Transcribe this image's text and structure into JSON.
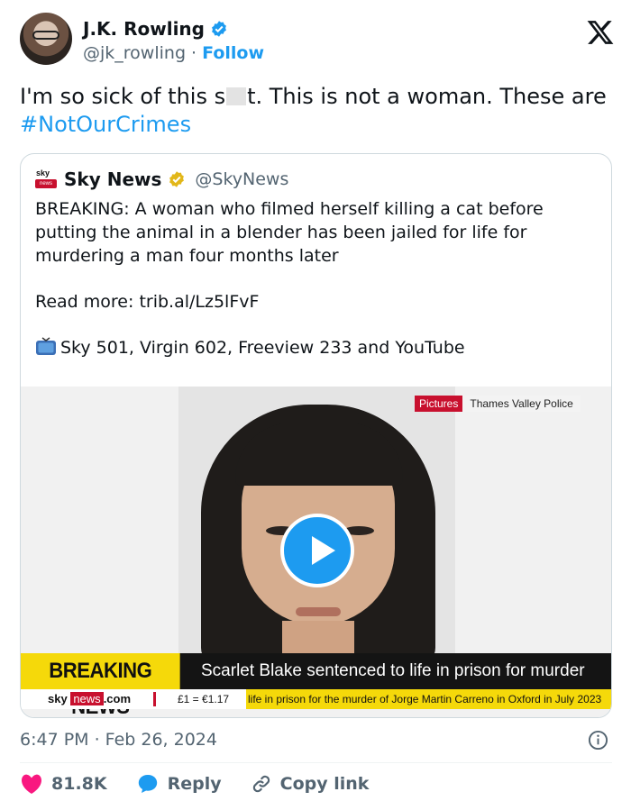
{
  "author": {
    "name": "J.K. Rowling",
    "handle": "@jk_rowling",
    "separator": " · ",
    "follow_label": "Follow"
  },
  "tweet": {
    "text_before": "I'm so sick of this s",
    "text_after": "t. This is not a woman. These are ",
    "hashtag": "#NotOurCrimes"
  },
  "quoted": {
    "logo_text": "sky",
    "logo_sub": "news",
    "name": "Sky News",
    "handle": "@SkyNews",
    "paragraph1": "BREAKING: A woman who filmed herself killing a cat before putting the animal in a blender has been jailed for life for murdering a man four months later",
    "paragraph2": "Read more: trib.al/Lz5lFvF",
    "paragraph3": "Sky 501, Virgin 602, Freeview 233 and YouTube",
    "video": {
      "credit_label": "Pictures",
      "credit_source": "Thames Valley Police",
      "breaking_label": "BREAKING NEWS",
      "headline": "Scarlet Blake sentenced to life in prison for murder",
      "ticker_logo": "sky",
      "ticker_logo_news": "news",
      "ticker_logo_suffix": ".com",
      "ticker_rate": "£1 = €1.17",
      "ticker_text": "life in prison for the murder of Jorge Martin Carreno in Oxford in July 2023"
    }
  },
  "timestamp": "6:47 PM · Feb 26, 2024",
  "actions": {
    "likes": "81.8K",
    "reply": "Reply",
    "copy_link": "Copy link"
  },
  "colors": {
    "accent": "#1d9bf0",
    "like": "#f91880",
    "sky_red": "#c8102e",
    "breaking_yellow": "#f5d90a"
  },
  "icons": [
    "verified-badge-icon",
    "x-logo-icon",
    "gold-verified-badge-icon",
    "tv-icon",
    "play-icon",
    "info-icon",
    "heart-icon",
    "reply-bubble-icon",
    "link-icon"
  ]
}
